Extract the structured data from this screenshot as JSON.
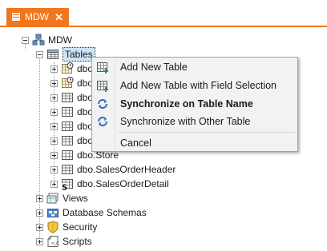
{
  "tab": {
    "title": "MDW",
    "close": "✕"
  },
  "tree": {
    "root": "MDW",
    "tables": "Tables",
    "table_items": [
      "dbo",
      "dbo",
      "dbo",
      "dbo",
      "dbo",
      "dbo",
      "dbo.Store",
      "dbo.SalesOrderHeader",
      "dbo.SalesOrderDetail"
    ],
    "views": "Views",
    "schemas": "Database Schemas",
    "security": "Security",
    "scripts": "Scripts"
  },
  "context_menu": {
    "add_table": "Add New Table",
    "add_table_fields": "Add New Table with Field Selection",
    "sync_name": "Synchronize on Table Name",
    "sync_other": "Synchronize with Other Table",
    "cancel": "Cancel"
  },
  "colors": {
    "accent": "#f0771d",
    "selection": "#cde3f7",
    "menu_bg": "#f2f2f2"
  }
}
